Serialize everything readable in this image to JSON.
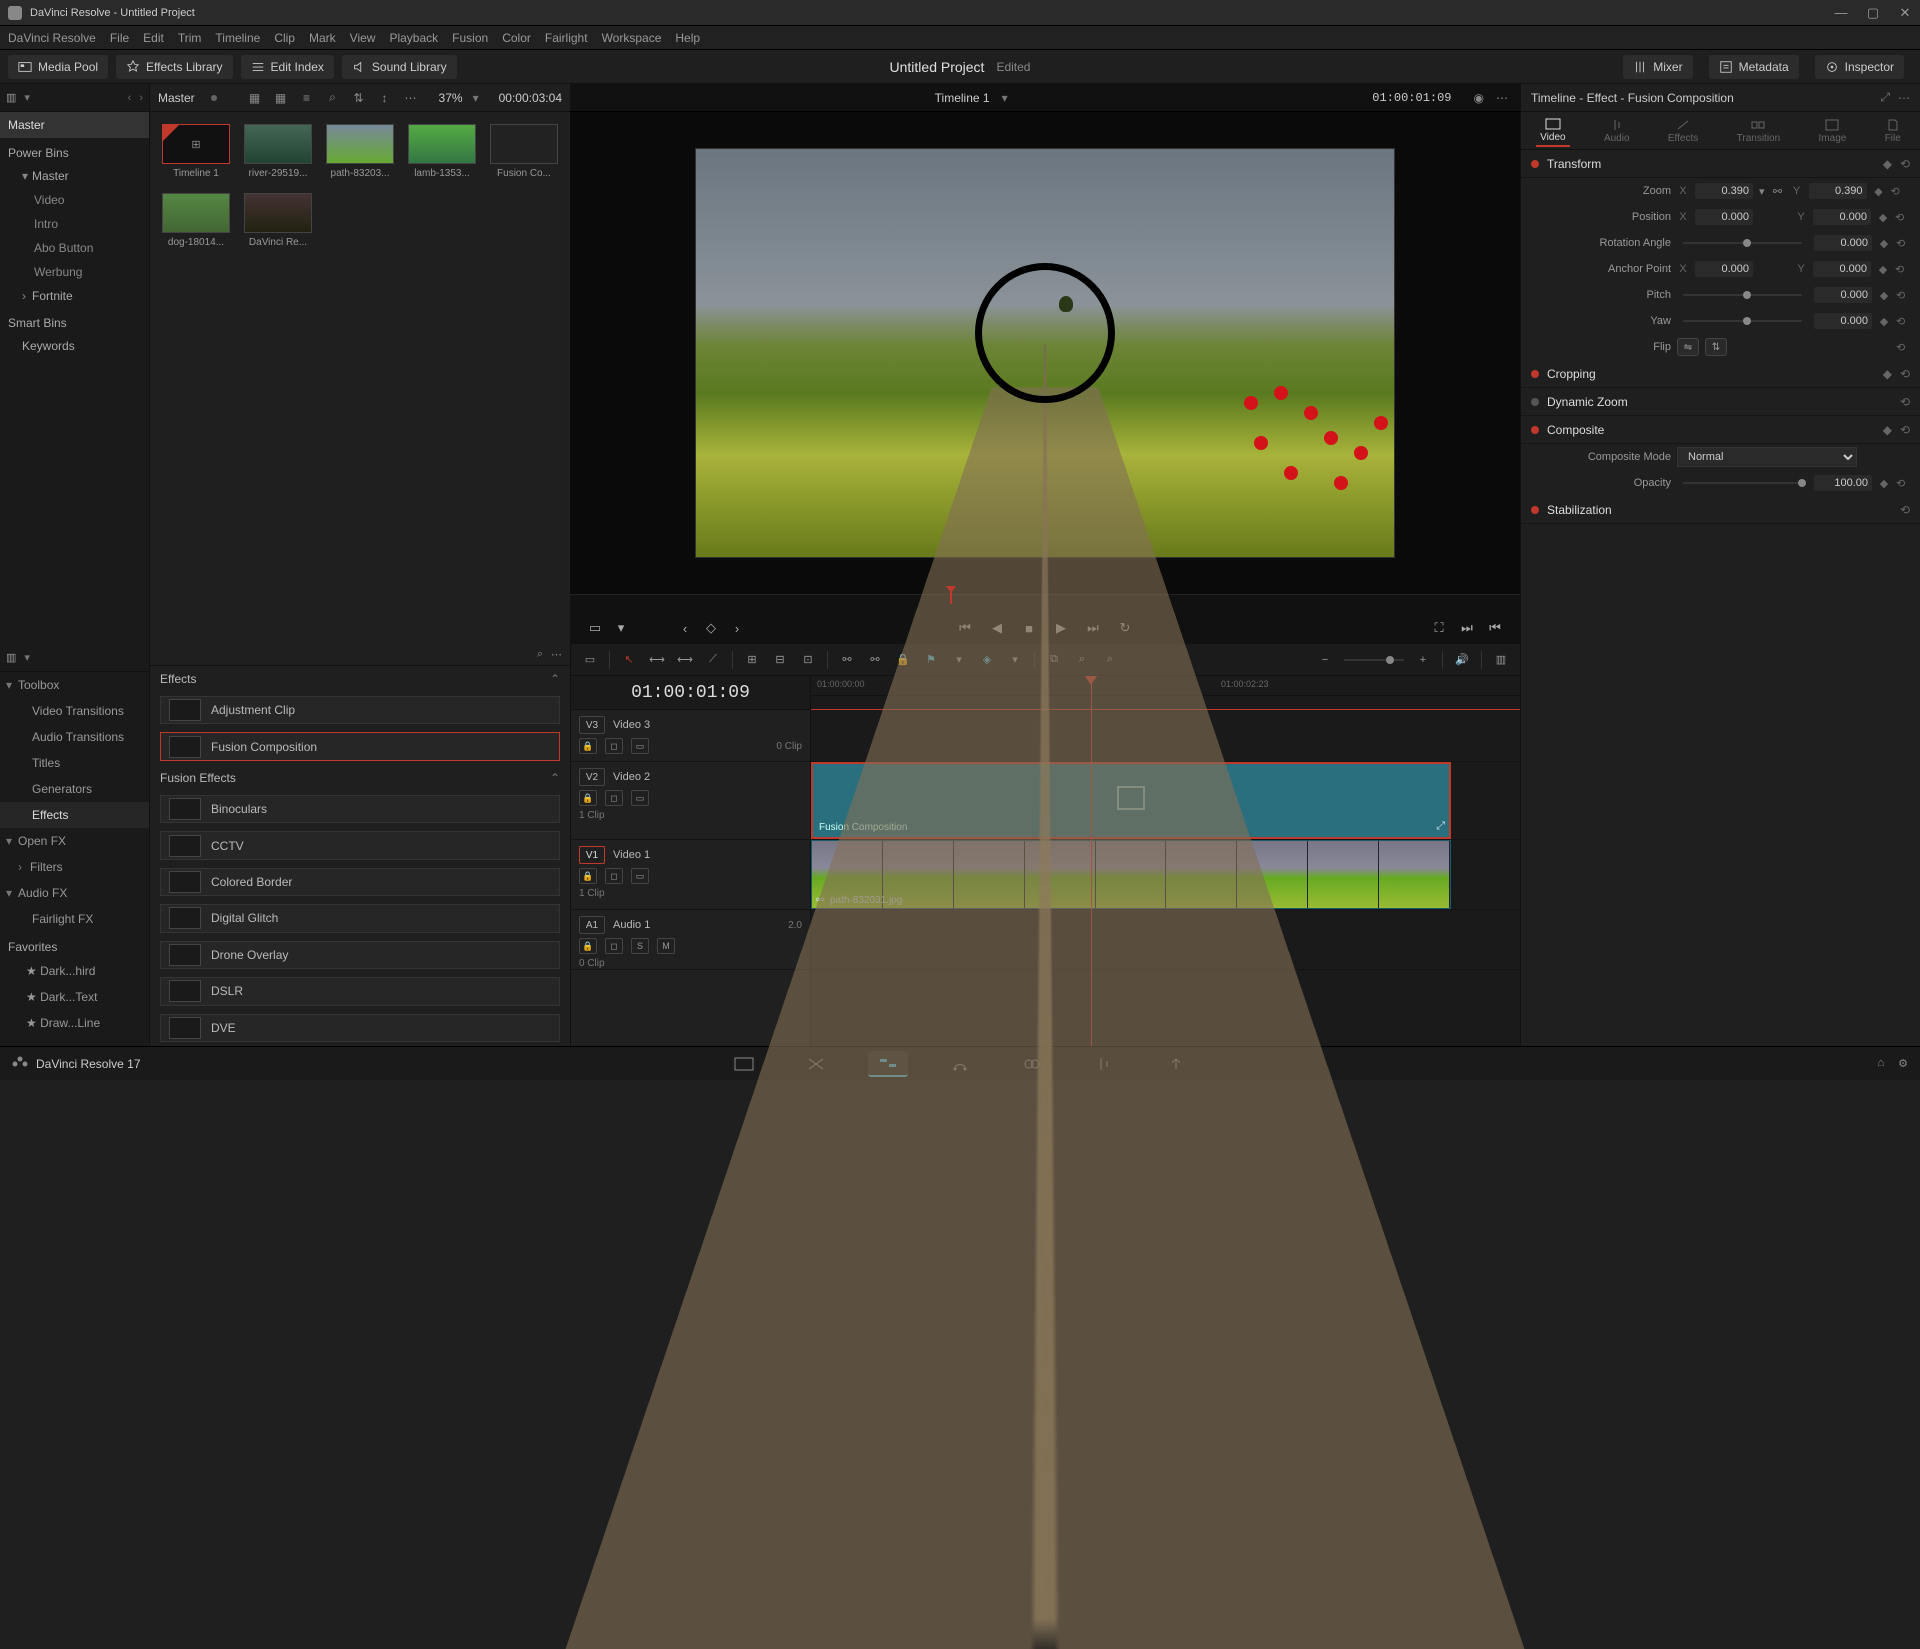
{
  "window": {
    "title": "DaVinci Resolve - Untitled Project"
  },
  "menu": [
    "DaVinci Resolve",
    "File",
    "Edit",
    "Trim",
    "Timeline",
    "Clip",
    "Mark",
    "View",
    "Playback",
    "Fusion",
    "Color",
    "Fairlight",
    "Workspace",
    "Help"
  ],
  "top_tabs": {
    "media_pool": "Media Pool",
    "effects_library": "Effects Library",
    "edit_index": "Edit Index",
    "sound_library": "Sound Library",
    "mixer": "Mixer",
    "metadata": "Metadata",
    "inspector": "Inspector"
  },
  "project": {
    "name": "Untitled Project",
    "status": "Edited"
  },
  "media_pool": {
    "master_label": "Master",
    "current_bin": "Master",
    "power_bins_label": "Power Bins",
    "power_bins": [
      "Master"
    ],
    "power_bins_children": [
      "Video",
      "Intro",
      "Abo Button",
      "Werbung",
      "Fortnite"
    ],
    "smart_bins_label": "Smart Bins",
    "smart_bins": [
      "Keywords"
    ],
    "zoom_pct": "37%",
    "duration": "00:00:03:04",
    "clips": [
      {
        "name": "Timeline 1",
        "selected": true
      },
      {
        "name": "river-29519..."
      },
      {
        "name": "path-83203..."
      },
      {
        "name": "lamb-1353..."
      },
      {
        "name": "Fusion Co..."
      },
      {
        "name": "dog-18014..."
      },
      {
        "name": "DaVinci Re..."
      }
    ]
  },
  "viewer": {
    "timeline_name": "Timeline 1",
    "timecode_in": "01:00:01:09"
  },
  "inspector": {
    "title": "Timeline - Effect - Fusion Composition",
    "tabs": [
      "Video",
      "Audio",
      "Effects",
      "Transition",
      "Image",
      "File"
    ],
    "active_tab": 0,
    "transform": {
      "label": "Transform",
      "zoom_label": "Zoom",
      "zoom_x": "0.390",
      "zoom_y": "0.390",
      "position_label": "Position",
      "pos_x": "0.000",
      "pos_y": "0.000",
      "rotation_label": "Rotation Angle",
      "rotation": "0.000",
      "anchor_label": "Anchor Point",
      "anchor_x": "0.000",
      "anchor_y": "0.000",
      "pitch_label": "Pitch",
      "pitch": "0.000",
      "yaw_label": "Yaw",
      "yaw": "0.000",
      "flip_label": "Flip"
    },
    "cropping_label": "Cropping",
    "dynamic_zoom_label": "Dynamic Zoom",
    "composite": {
      "label": "Composite",
      "mode_label": "Composite Mode",
      "mode": "Normal",
      "opacity_label": "Opacity",
      "opacity": "100.00"
    },
    "stabilization_label": "Stabilization"
  },
  "effects_library": {
    "toolbox_label": "Toolbox",
    "toolbox": [
      "Video Transitions",
      "Audio Transitions",
      "Titles",
      "Generators",
      "Effects"
    ],
    "toolbox_active": 4,
    "openfx_label": "Open FX",
    "openfx": [
      "Filters"
    ],
    "audiofx_label": "Audio FX",
    "audiofx": [
      "Fairlight FX"
    ],
    "favorites_label": "Favorites",
    "favorites": [
      "Dark...hird",
      "Dark...Text",
      "Draw...Line"
    ],
    "effects_section": "Effects",
    "effects_items": [
      {
        "name": "Adjustment Clip"
      },
      {
        "name": "Fusion Composition",
        "selected": true
      }
    ],
    "fusion_section": "Fusion Effects",
    "fusion_items": [
      "Binoculars",
      "CCTV",
      "Colored Border",
      "Digital Glitch",
      "Drone Overlay",
      "DSLR",
      "DVE"
    ]
  },
  "timeline": {
    "timecode": "01:00:01:09",
    "ruler": [
      "01:00:00:00",
      "01:00:02:23"
    ],
    "tracks": {
      "v3": {
        "badge": "V3",
        "name": "Video 3",
        "clips": "0 Clip"
      },
      "v2": {
        "badge": "V2",
        "name": "Video 2",
        "clips": "1 Clip",
        "clip_name": "Fusion Composition"
      },
      "v1": {
        "badge": "V1",
        "name": "Video 1",
        "clips": "1 Clip",
        "clip_name": "path-832031.jpg"
      },
      "a1": {
        "badge": "A1",
        "name": "Audio 1",
        "meter": "2.0",
        "clips": "0 Clip"
      }
    }
  },
  "footer": {
    "version": "DaVinci Resolve 17"
  }
}
